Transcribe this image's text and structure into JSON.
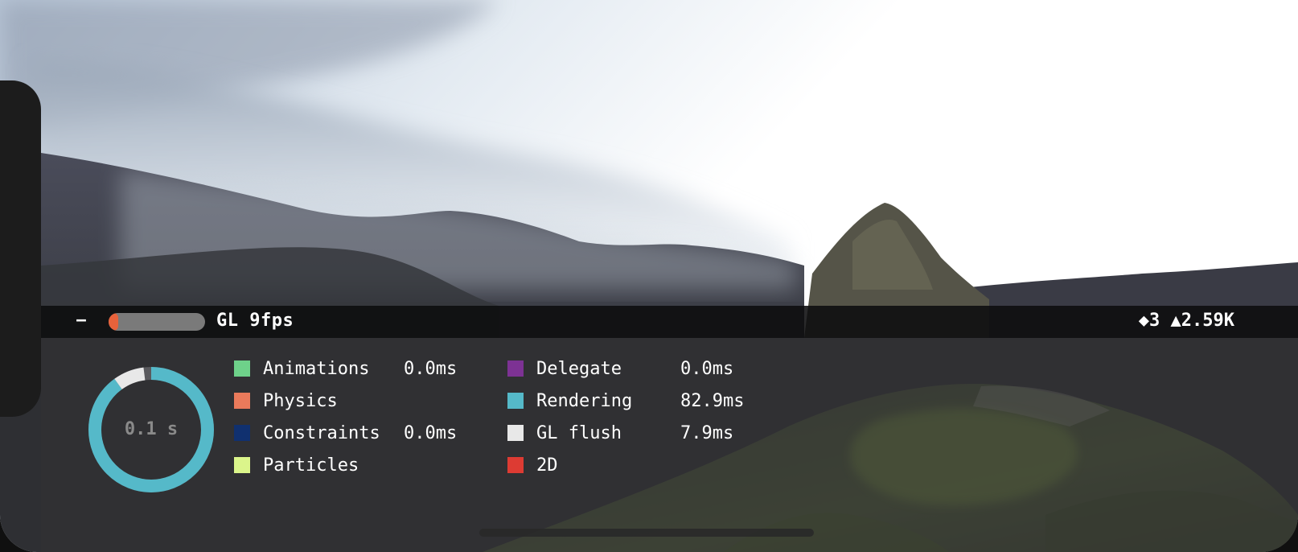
{
  "stats_bar": {
    "collapse_label": "−",
    "fps_text": "GL 9fps",
    "fps_fill_fraction": 0.08,
    "counts_text": "◆3 ▲2.59K"
  },
  "timing_ring": {
    "label": "0.1 s",
    "segments": [
      {
        "name": "Rendering",
        "fraction": 0.9,
        "color": "#55b9c9"
      },
      {
        "name": "GL flush",
        "fraction": 0.08,
        "color": "#e8e8e8"
      }
    ],
    "track_color": "#5a5a5e"
  },
  "legend": {
    "left": [
      {
        "label": "Animations",
        "value": "0.0ms",
        "color": "#6ed18a"
      },
      {
        "label": "Physics",
        "value": "",
        "color": "#ea7a5b"
      },
      {
        "label": "Constraints",
        "value": "0.0ms",
        "color": "#10306f"
      },
      {
        "label": "Particles",
        "value": "",
        "color": "#dbf58b"
      }
    ],
    "right": [
      {
        "label": "Delegate",
        "value": "0.0ms",
        "color": "#7d3294"
      },
      {
        "label": "Rendering",
        "value": "82.9ms",
        "color": "#55b9c9"
      },
      {
        "label": "GL flush",
        "value": "7.9ms",
        "color": "#e8e8e8"
      },
      {
        "label": "2D",
        "value": "",
        "color": "#dd3b33"
      }
    ]
  }
}
